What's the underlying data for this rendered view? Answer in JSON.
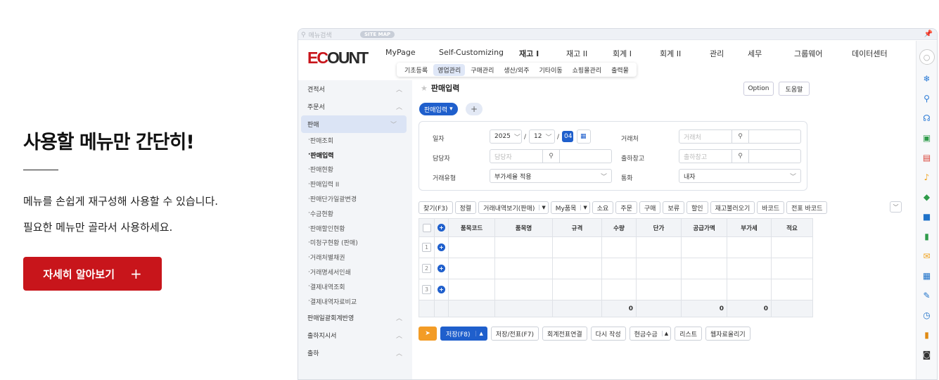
{
  "hero": {
    "title": "사용할 메뉴만 간단히!",
    "desc1": "메뉴를 손쉽게 재구성해 사용할 수 있습니다.",
    "desc2": "필요한 메뉴만 골라서 사용하세요.",
    "cta_label": "자세히 알아보기",
    "cta_plus": "+"
  },
  "app": {
    "search_placeholder": "메뉴검색",
    "sitemap_label": "SITE MAP",
    "logo_ec": "EC",
    "logo_rest": "OUNT",
    "topnav": [
      "MyPage",
      "Self-Customizing",
      "재고 I",
      "재고 II",
      "회계 I",
      "회계 II",
      "관리",
      "세무",
      "그룹웨어",
      "데이터센터"
    ],
    "subnav": [
      "기초등록",
      "영업관리",
      "구매관리",
      "생산/외주",
      "기타이동",
      "쇼핑몰관리",
      "출력물"
    ],
    "subnav_active": 1,
    "sidebar": {
      "cats_top": [
        "견적서",
        "주문서"
      ],
      "active_cat": "판매",
      "items": [
        "판매조회",
        "판매입력",
        "판매현황",
        "판매입력 II",
        "판매단가일괄변경",
        "수금현황",
        "판매할인현황",
        "미청구현황 (판매)",
        "거래처별채권",
        "거래명세서인쇄",
        "결제내역조회",
        "결제내역자료비교"
      ],
      "selected_item": "판매입력",
      "cats_bottom": [
        "판매일괄회계반영",
        "출하지시서",
        "출하"
      ]
    },
    "page_title": "판매입력",
    "option_label": "Option",
    "help_label": "도움말",
    "tab_label": "판매입력",
    "tab_plus": "+",
    "form": {
      "date_label": "일자",
      "year": "2025",
      "month": "12",
      "day": "04",
      "customer_label": "거래처",
      "customer_placeholder": "거래처",
      "manager_label": "담당자",
      "manager_placeholder": "담당자",
      "warehouse_label": "출하창고",
      "warehouse_placeholder": "출하창고",
      "trade_type_label": "거래유형",
      "trade_type_value": "부가세율 적용",
      "currency_label": "통화",
      "currency_value": "내자"
    },
    "toolbar": [
      "찾기(F3)",
      "정렬",
      "거래내역보기(판매)",
      "My품목",
      "소요",
      "주문",
      "구매",
      "보류",
      "할인",
      "재고불러오기",
      "바코드",
      "전표 바코드"
    ],
    "grid": {
      "headers": [
        "품목코드",
        "품목명",
        "규격",
        "수량",
        "단가",
        "공급가액",
        "부가세",
        "적요"
      ],
      "rows": [
        "1",
        "2",
        "3"
      ],
      "totals": {
        "qty": "0",
        "supply": "0",
        "vat": "0"
      }
    },
    "bottom": {
      "save": "저장(F8)",
      "save_new": "저장/전표(F7)",
      "link": "회계전표연결",
      "rewrite": "다시 작성",
      "cash": "현금수금",
      "list": "리스트",
      "upload": "웹자료올리기"
    },
    "right_icons": [
      "user-icon",
      "snowflake-icon",
      "search-icon",
      "headset-icon",
      "add-doc-icon",
      "calendar-icon",
      "bell-icon",
      "share-icon",
      "chat-icon",
      "phone-icon",
      "mail-icon",
      "board-icon",
      "edit-icon",
      "clock-icon",
      "folder-icon",
      "camera-icon"
    ]
  }
}
